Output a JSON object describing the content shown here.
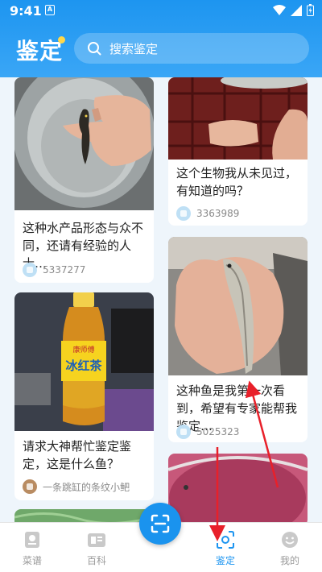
{
  "status": {
    "time": "9:41",
    "sim": "A"
  },
  "header": {
    "title": "鉴定",
    "search_placeholder": "搜索鉴定"
  },
  "cards": [
    {
      "caption": "这种水产品形态与众不同，还请有经验的人士…",
      "count": "5337277"
    },
    {
      "caption": "这个生物我从未见过，有知道的吗？",
      "count": "3363989"
    },
    {
      "caption": "这种鱼是我第一次看到，希望有专家能帮我鉴定…",
      "count": "5025323"
    },
    {
      "caption": "请求大神帮忙鉴定鉴定，这是什么鱼？",
      "user": "一条跳缸的条纹小鲃"
    }
  ],
  "bottle": {
    "brand": "康师傅",
    "product": "冰红茶"
  },
  "nav": [
    {
      "label": "菜谱",
      "icon": "recipe-icon"
    },
    {
      "label": "百科",
      "icon": "encyclopedia-icon"
    },
    {
      "label": "鉴定",
      "icon": "scan-identify-icon",
      "active": true
    },
    {
      "label": "我的",
      "icon": "profile-face-icon"
    }
  ],
  "colors": {
    "primary": "#1d95f0",
    "accent_dot": "#ffd84a",
    "annotation": "#e8202a"
  }
}
